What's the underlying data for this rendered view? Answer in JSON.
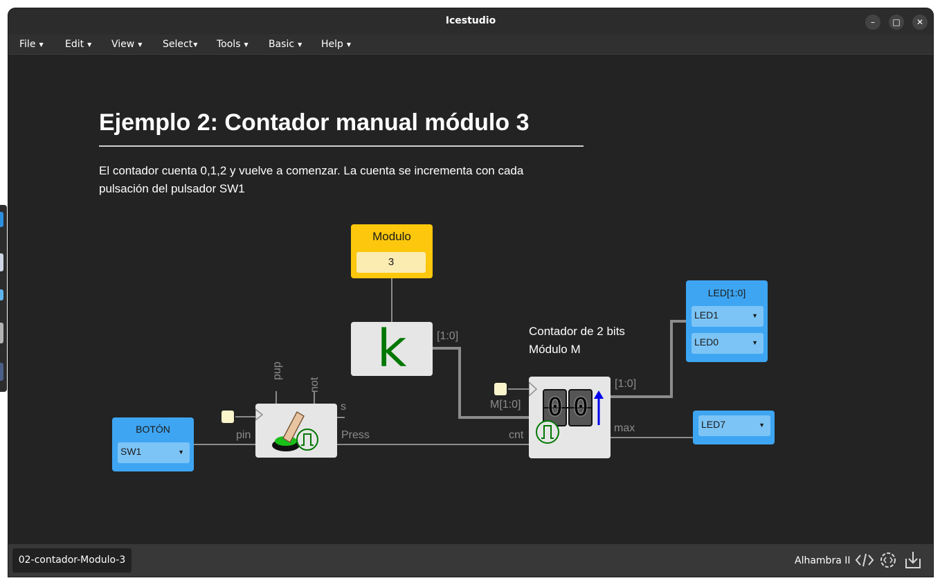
{
  "window": {
    "title": "Icestudio"
  },
  "window_controls": {
    "minimize": "–",
    "maximize": "□",
    "close": "✕"
  },
  "menubar": {
    "items": [
      {
        "label": "File"
      },
      {
        "label": "Edit"
      },
      {
        "label": "View"
      },
      {
        "label": "Select"
      },
      {
        "label": "Tools"
      },
      {
        "label": "Basic"
      },
      {
        "label": "Help"
      }
    ]
  },
  "canvas": {
    "heading": "Ejemplo 2: Contador manual módulo 3",
    "description": "El contador cuenta 0,1,2 y vuelve a comenzar. La cuenta se incrementa con cada pulsación del pulsador SW1",
    "counter_note_line1": "Contador de 2 bits",
    "counter_note_line2": "Módulo M"
  },
  "blocks": {
    "modulo": {
      "title": "Modulo",
      "value": "3"
    },
    "constant": {
      "glyph": "k",
      "output_label": "[1:0]"
    },
    "boton": {
      "title": "BOTÓN",
      "selected": "SW1",
      "port_label": "pin"
    },
    "button_block": {
      "ports": {
        "pup": "pup",
        "not": "not",
        "s": "s",
        "output": "Press"
      }
    },
    "counter": {
      "ports": {
        "m": "M[1:0]",
        "cnt": "cnt",
        "output": "[1:0]",
        "max": "max"
      },
      "digits": [
        "0",
        "0"
      ]
    },
    "led10": {
      "title": "LED[1:0]",
      "selects": [
        "LED1",
        "LED0"
      ]
    },
    "led7": {
      "selected": "LED7"
    }
  },
  "colors": {
    "input_block": "#3ea5f2",
    "constant_block": "#fcc70c",
    "wire": "#8c8c8c",
    "background": "#232323",
    "accent_green": "#007700"
  },
  "statusbar": {
    "file_tab": "02-contador-Modulo-3",
    "board": "Alhambra II",
    "icons": [
      "code-icon",
      "settings-code-icon",
      "upload-icon"
    ]
  }
}
